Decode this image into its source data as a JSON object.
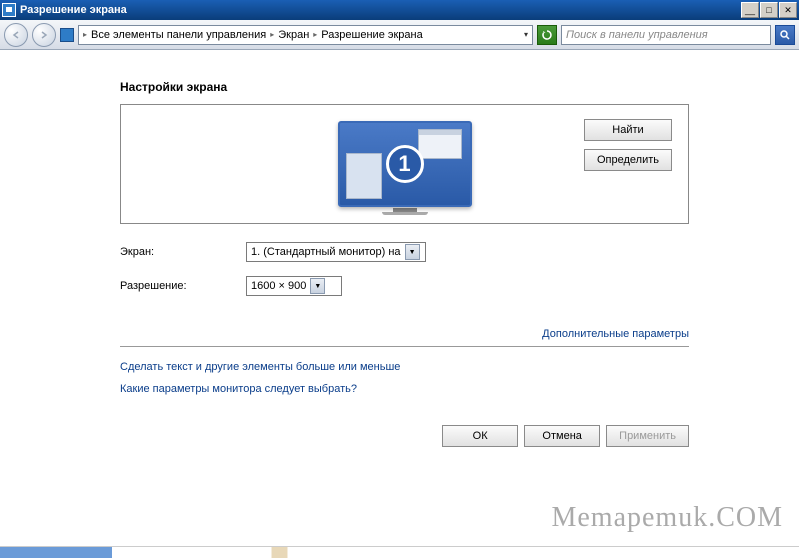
{
  "titlebar": {
    "title": "Разрешение экрана"
  },
  "breadcrumb": {
    "parts": [
      "Все элементы панели управления",
      "Экран",
      "Разрешение экрана"
    ]
  },
  "search": {
    "placeholder": "Поиск в панели управления"
  },
  "page": {
    "heading": "Настройки экрана",
    "find_btn": "Найти",
    "detect_btn": "Определить",
    "monitor_number": "1"
  },
  "form": {
    "screen_label": "Экран:",
    "screen_value": "1. (Стандартный монитор) на",
    "resolution_label": "Разрешение:",
    "resolution_value": "1600 × 900"
  },
  "links": {
    "advanced": "Дополнительные параметры",
    "text_size": "Сделать текст и другие элементы больше или меньше",
    "params_help": "Какие параметры монитора следует выбрать?"
  },
  "buttons": {
    "ok": "ОК",
    "cancel": "Отмена",
    "apply": "Применить"
  },
  "watermark": "Memapemuk.COM"
}
